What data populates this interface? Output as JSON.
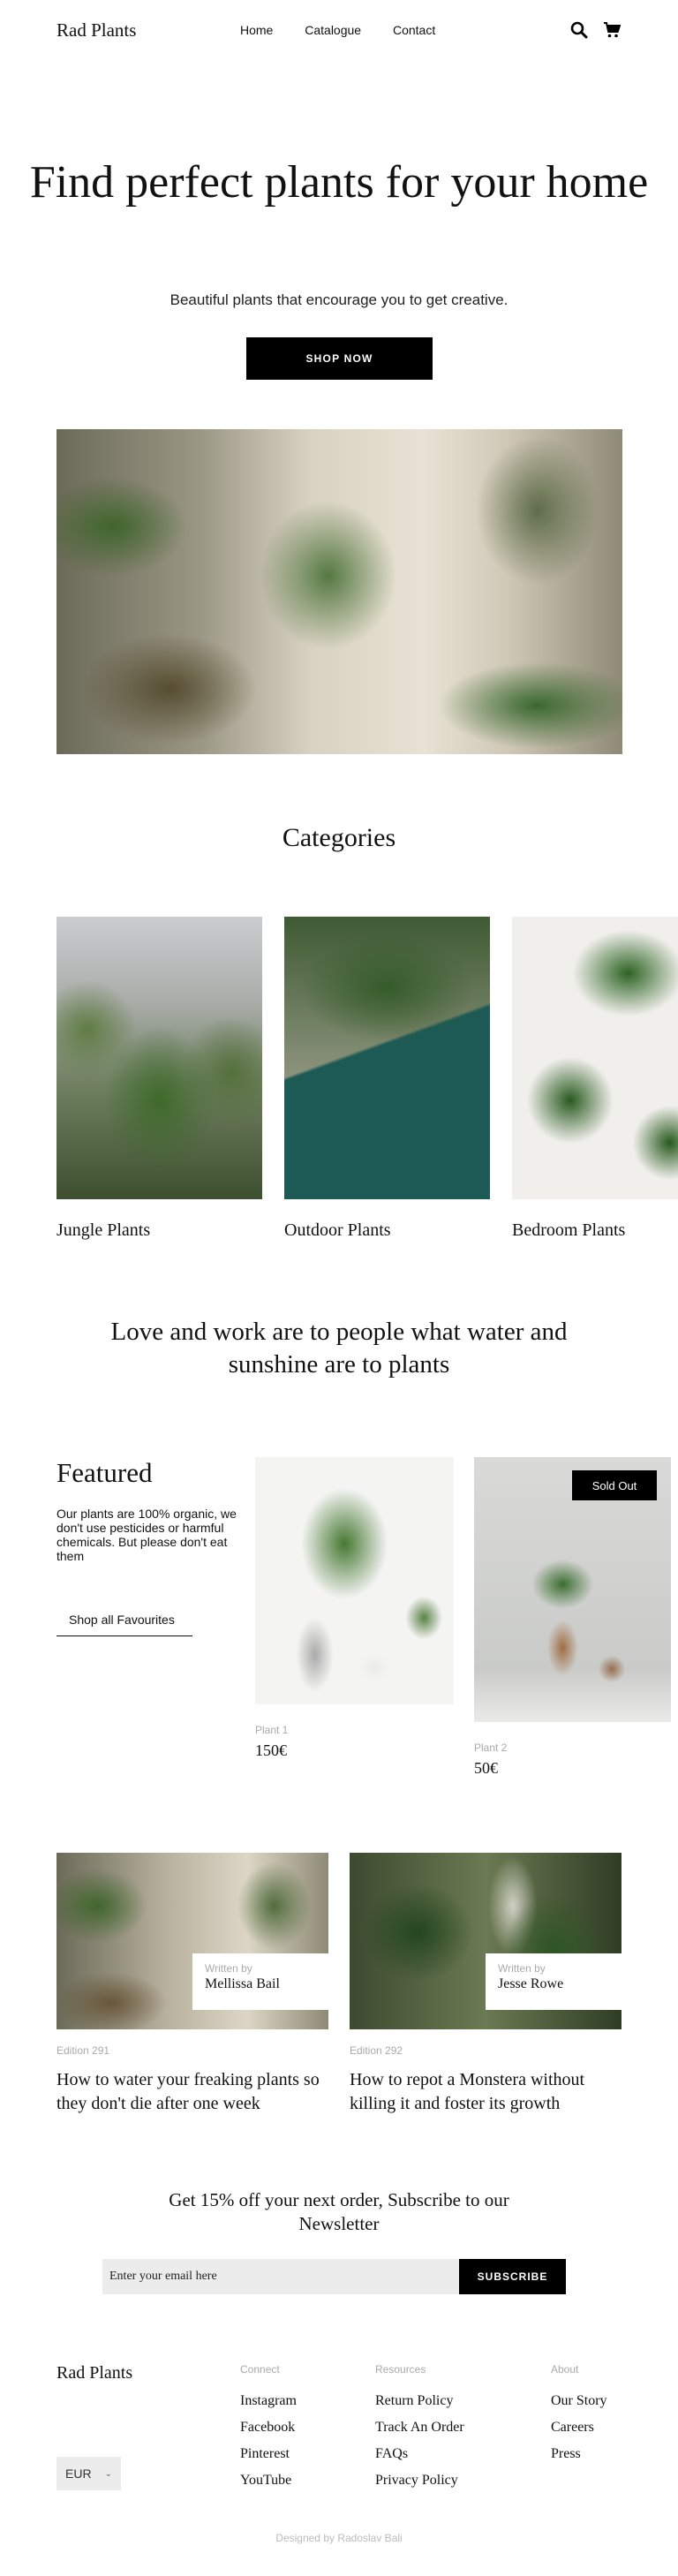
{
  "header": {
    "logo": "Rad Plants",
    "nav": [
      "Home",
      "Catalogue",
      "Contact"
    ],
    "icons": [
      "search-icon",
      "cart-icon"
    ]
  },
  "hero": {
    "title": "Find perfect plants  for your home",
    "subtitle": "Beautiful plants that encourage you to get creative.",
    "cta": "SHOP NOW"
  },
  "categories": {
    "title": "Categories",
    "items": [
      "Jungle Plants",
      "Outdoor Plants",
      "Bedroom Plants"
    ]
  },
  "quote": "Love and work are to people what water and sunshine are to plants",
  "featured": {
    "title": "Featured",
    "description": "Our plants are 100% organic, we don't use pesticides or harmful chemicals. But please don't eat them",
    "link": "Shop all Favourites",
    "products": [
      {
        "name": "Plant 1",
        "price": "150€",
        "badge": ""
      },
      {
        "name": "Plant 2",
        "price": "50€",
        "badge": "Sold Out"
      }
    ]
  },
  "blog": [
    {
      "written_by": "Written by",
      "author": "Mellissa Bail",
      "edition": "Edition 291",
      "title": "How to water your freaking plants so they don't die after one week"
    },
    {
      "written_by": "Written by",
      "author": "Jesse Rowe",
      "edition": "Edition 292",
      "title": "How to repot a Monstera without killing it and foster its growth"
    }
  ],
  "newsletter": {
    "title": "Get 15% off your next order,  Subscribe to our Newsletter",
    "placeholder": "Enter your email here",
    "button": "SUBSCRIBE"
  },
  "footer": {
    "logo": "Rad Plants",
    "currency": "EUR",
    "columns": [
      {
        "heading": "Connect",
        "links": [
          "Instagram",
          "Facebook",
          "Pinterest",
          "YouTube"
        ]
      },
      {
        "heading": "Resources",
        "links": [
          "Return Policy",
          "Track An Order",
          "FAQs",
          "Privacy Policy"
        ]
      },
      {
        "heading": "About",
        "links": [
          "Our Story",
          "Careers",
          "Press"
        ]
      }
    ],
    "credit": "Designed by Radoslav Bali"
  }
}
